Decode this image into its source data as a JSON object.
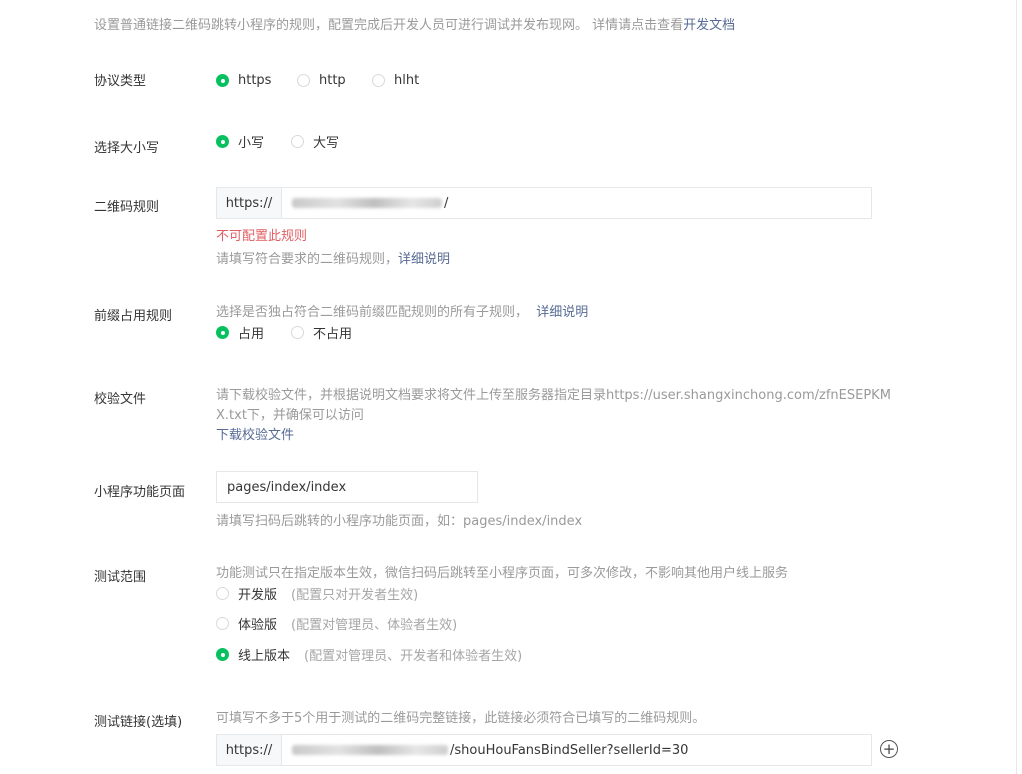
{
  "intro": {
    "text": "设置普通链接二维码跳转小程序的规则，配置完成后开发人员可进行调试并发布现网。 详情请点击查看",
    "link": "开发文档"
  },
  "protocol": {
    "label": "协议类型",
    "options": [
      {
        "label": "https",
        "checked": true
      },
      {
        "label": "http",
        "checked": false
      },
      {
        "label": "hlht",
        "checked": false
      }
    ]
  },
  "case": {
    "label": "选择大小写",
    "options": [
      {
        "label": "小写",
        "checked": true
      },
      {
        "label": "大写",
        "checked": false
      }
    ]
  },
  "qr_rule": {
    "label": "二维码规则",
    "prefix": "https://",
    "value_suffix": "/",
    "error": "不可配置此规则",
    "help": "请填写符合要求的二维码规则，",
    "help_link": "详细说明"
  },
  "prefix_rule": {
    "label": "前缀占用规则",
    "desc": "选择是否独占符合二维码前缀匹配规则的所有子规则，",
    "desc_link": "详细说明",
    "options": [
      {
        "label": "占用",
        "checked": true
      },
      {
        "label": "不占用",
        "checked": false
      }
    ]
  },
  "verify_file": {
    "label": "校验文件",
    "desc_line1": "请下载校验文件，并根据说明文档要求将文件上传至服务器指定目录https://user.shangxinchong.com/zfnESEPKM",
    "desc_line2": "X.txt下，并确保可以访问",
    "download": "下载校验文件"
  },
  "page_path": {
    "label": "小程序功能页面",
    "value": "pages/index/index",
    "help": "请填写扫码后跳转的小程序功能页面，如：pages/index/index"
  },
  "test_scope": {
    "label": "测试范围",
    "desc": "功能测试只在指定版本生效，微信扫码后跳转至小程序页面，可多次修改，不影响其他用户线上服务",
    "options": [
      {
        "label": "开发版",
        "hint": "(配置只对开发者生效)",
        "checked": false
      },
      {
        "label": "体验版",
        "hint": "(配置对管理员、体验者生效)",
        "checked": false
      },
      {
        "label": "线上版本",
        "hint": "(配置对管理员、开发者和体验者生效)",
        "checked": true
      }
    ]
  },
  "test_link": {
    "label": "测试链接(选填)",
    "desc": "可填写不多于5个用于测试的二维码完整链接，此链接必须符合已填写的二维码规则。",
    "prefix": "https://",
    "value_suffix": "/shouHouFansBindSeller?sellerId=30",
    "add_icon": "plus-circle-icon"
  },
  "colors": {
    "accent": "#07c160",
    "link": "#576b95",
    "error": "#e15f63",
    "muted": "#9a9a9a"
  }
}
